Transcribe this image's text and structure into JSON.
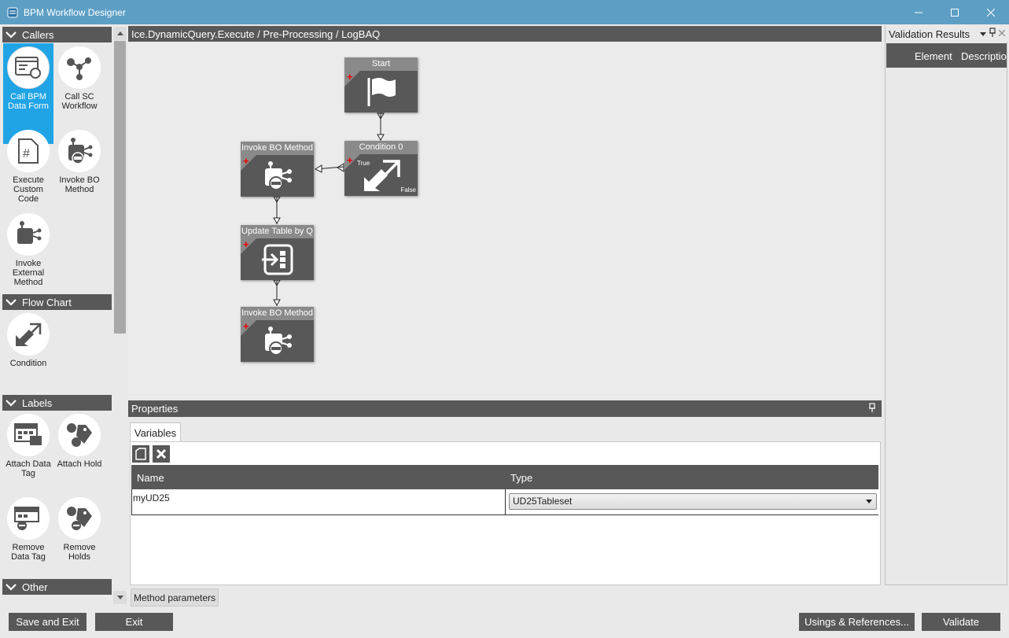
{
  "window": {
    "title": "BPM Workflow Designer"
  },
  "toolbox": {
    "sections": {
      "callers": "Callers",
      "flow_chart": "Flow Chart",
      "labels": "Labels",
      "other": "Other"
    },
    "tools": {
      "call_bpm_data_form": "Call BPM Data Form",
      "call_sc_workflow": "Call SC Workflow",
      "execute_custom_code": "Execute Custom Code",
      "invoke_bo_method": "Invoke BO Method",
      "invoke_external_method": "Invoke External Method",
      "condition": "Condition",
      "attach_data_tag": "Attach Data Tag",
      "attach_hold": "Attach Hold",
      "remove_data_tag": "Remove Data Tag",
      "remove_holds": "Remove Holds"
    },
    "selected_tool": "call_bpm_data_form"
  },
  "canvas": {
    "breadcrumb": "Ice.DynamicQuery.Execute / Pre-Processing / LogBAQ",
    "nodes": {
      "start": "Start",
      "condition": "Condition 0",
      "invoke1": "Invoke BO Method",
      "update_table": "Update Table by Q",
      "invoke2": "Invoke BO Method"
    },
    "branch_labels": {
      "true": "True",
      "false": "False"
    }
  },
  "properties": {
    "title": "Properties",
    "tab": "Variables",
    "columns": {
      "name": "Name",
      "type": "Type"
    },
    "rows": [
      {
        "name": "myUD25",
        "type": "UD25Tableset"
      }
    ],
    "bottom_tab": "Method parameters"
  },
  "validation": {
    "title": "Validation Results",
    "columns": {
      "element": "Element",
      "description": "Description"
    }
  },
  "buttons": {
    "save_and_exit": "Save and Exit",
    "exit": "Exit",
    "usings": "Usings & References...",
    "validate": "Validate"
  },
  "colors": {
    "titlebar": "#5d9fc4",
    "selected": "#20a4e6",
    "dark": "#585858",
    "node_header": "#8a8a8a"
  }
}
